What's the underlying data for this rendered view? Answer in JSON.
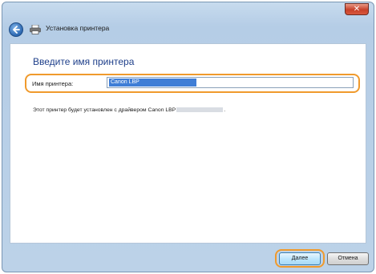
{
  "window": {
    "title": "Установка принтера",
    "close_label": "✕"
  },
  "content": {
    "heading": "Введите имя принтера",
    "name_label": "Имя принтера:",
    "name_value": "Canon LBP",
    "info_text": "Этот принтер будет установлен с драйвером Canon LBP",
    "info_suffix": "."
  },
  "buttons": {
    "next": "Далее",
    "cancel": "Отмена"
  },
  "colors": {
    "highlight": "#f09a2c",
    "heading": "#1e3f8a",
    "selection": "#3f7ed6"
  }
}
